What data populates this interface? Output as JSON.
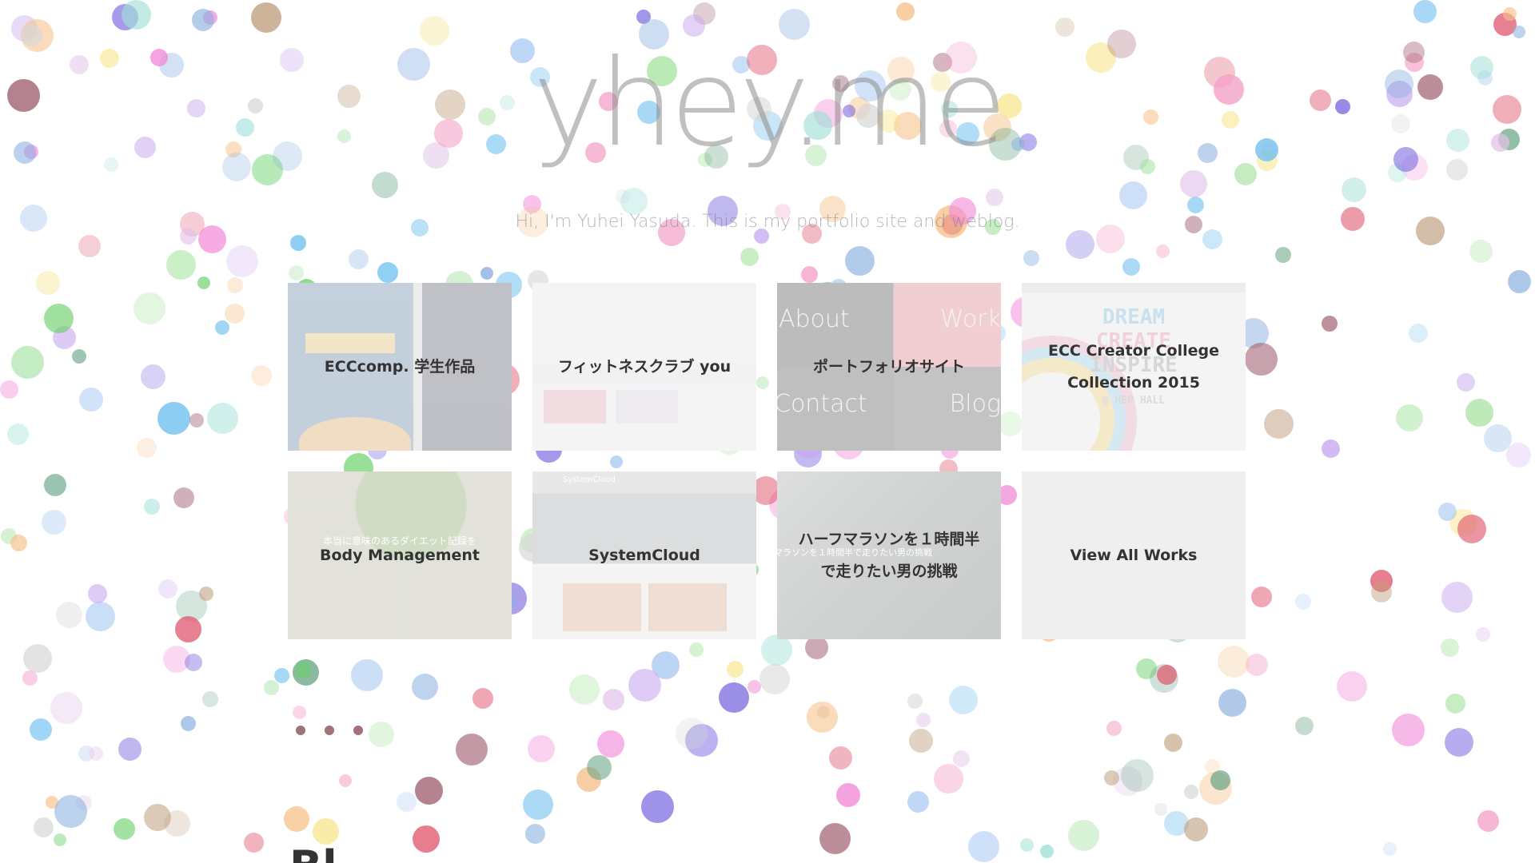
{
  "site": {
    "logo": "yhey.me",
    "tagline": "Hi, I'm Yuhei Yasuda. This is my portfolio site and weblog."
  },
  "works": [
    {
      "label": "ECCcomp. 学生作品",
      "thumb_text": "ECCcomp 学生作品"
    },
    {
      "label": "フィットネスクラブ you",
      "thumb_text": "you"
    },
    {
      "label": "ポートフォリオサイト",
      "thumb_words": [
        "About",
        "Work",
        "Contact",
        "Blog"
      ]
    },
    {
      "label": "ECC Creator College\nCollection 2015",
      "thumb_words": [
        "DREAM",
        "CREATE",
        "INSPIRE"
      ],
      "thumb_caption": "@ HEP HALL"
    },
    {
      "label": "Body Management",
      "thumb_caption": "本当に意味のあるダイエット記録を"
    },
    {
      "label": "SystemCloud",
      "thumb_caption": "SystemCloud"
    },
    {
      "label": "ハーフマラソンを１時間半\nで走りたい男の挑戦",
      "thumb_caption": "マラソンを１時間半で走りたい男の挑戦"
    },
    {
      "label": "View All Works"
    }
  ],
  "next_section": {
    "heading_fragment": "Bl"
  },
  "colors": {
    "label_text": "#333333",
    "logo": "#8c8c8c",
    "dot_indicator": "#a0727a"
  }
}
